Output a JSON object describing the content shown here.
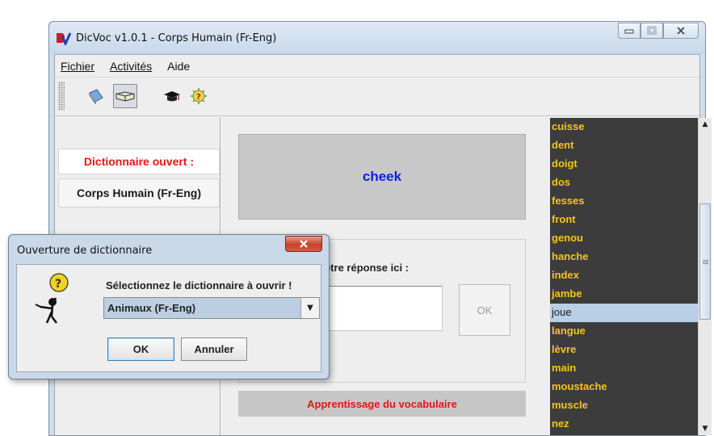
{
  "window": {
    "title": "DicVoc v1.0.1  -  Corps Humain (Fr-Eng)",
    "controls": [
      "minimize",
      "maximize",
      "close"
    ]
  },
  "menu": {
    "items": [
      {
        "label": "Fichier"
      },
      {
        "label": "Activités"
      },
      {
        "label": "Aide"
      }
    ]
  },
  "toolbar": {
    "buttons": [
      {
        "icon": "closed-book-icon"
      },
      {
        "icon": "open-book-icon",
        "pressed": true
      },
      {
        "icon": "graduation-cap-icon"
      },
      {
        "icon": "quiz-icon"
      }
    ]
  },
  "left_panel": {
    "status_label": "Dictionnaire ouvert :",
    "dictionary_name": "Corps Humain (Fr-Eng)"
  },
  "center_panel": {
    "current_word": "cheek",
    "answer_label": "Entrez votre réponse ici :",
    "ok_label": "OK",
    "mode_label": "Apprentissage du vocabulaire"
  },
  "word_list": {
    "items": [
      "cuisse",
      "dent",
      "doigt",
      "dos",
      "fesses",
      "front",
      "genou",
      "hanche",
      "index",
      "jambe",
      "joue",
      "langue",
      "lèvre",
      "main",
      "moustache",
      "muscle",
      "nez"
    ],
    "selected": "joue"
  },
  "dialog": {
    "title": "Ouverture de dictionnaire",
    "prompt": "Sélectionnez le dictionnaire à ouvrir !",
    "selected_dictionary": "Animaux (Fr-Eng)",
    "ok_label": "OK",
    "cancel_label": "Annuler"
  },
  "colors": {
    "word_list_bg": "#3c3c3c",
    "word_list_text": "#f5c518",
    "accent_red": "#e01818",
    "word_blue": "#0a1fe0"
  }
}
